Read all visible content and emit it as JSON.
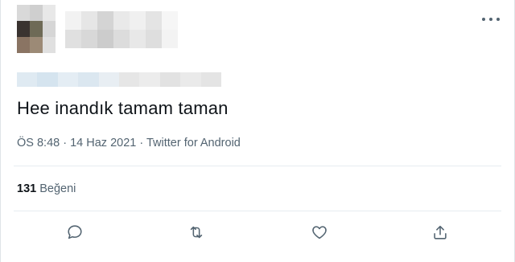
{
  "tweet": {
    "text": "Hee inandık tamam taman",
    "time": "ÖS 8:48",
    "separator": "·",
    "date": "14 Haz 2021",
    "source": "Twitter for Android"
  },
  "stats": {
    "likes_count": "131",
    "likes_label": "Beğeni"
  },
  "icons": {
    "more": "more-horizontal-icon",
    "reply": "reply-icon",
    "retweet": "retweet-icon",
    "like": "like-icon",
    "share": "share-icon"
  },
  "colors": {
    "text": "#0f1419",
    "secondary": "#536471",
    "divider": "#e6ecf0"
  }
}
